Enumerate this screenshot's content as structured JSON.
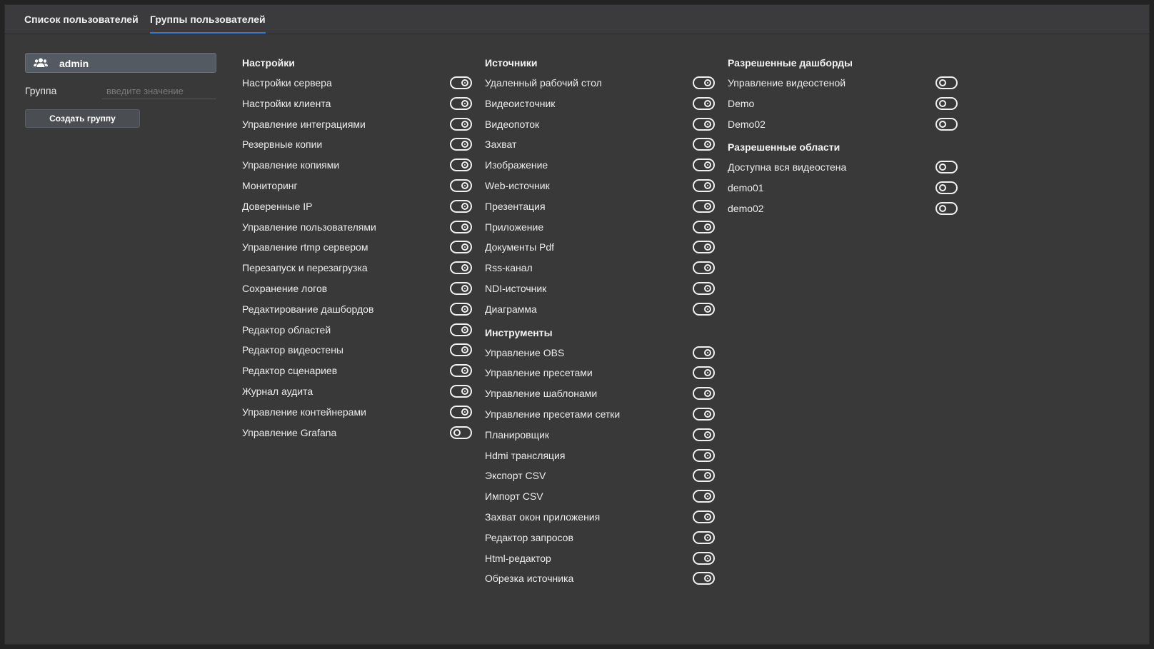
{
  "tabs": [
    {
      "label": "Список пользователей",
      "active": false
    },
    {
      "label": "Группы пользователей",
      "active": true
    }
  ],
  "sidebar": {
    "group_icon": "users-icon",
    "selected_group": "admin",
    "group_field_label": "Группа",
    "group_field_placeholder": "введите значение",
    "create_button": "Создать группу"
  },
  "settings": {
    "title": "Настройки",
    "items": [
      {
        "label": "Настройки сервера",
        "on": true
      },
      {
        "label": "Настройки клиента",
        "on": true
      },
      {
        "label": "Управление интеграциями",
        "on": true
      },
      {
        "label": "Резервные копии",
        "on": true
      },
      {
        "label": "Управление копиями",
        "on": true
      },
      {
        "label": "Мониторинг",
        "on": true
      },
      {
        "label": "Доверенные IP",
        "on": true
      },
      {
        "label": "Управление пользователями",
        "on": true
      },
      {
        "label": "Управление rtmp сервером",
        "on": true
      },
      {
        "label": "Перезапуск и перезагрузка",
        "on": true
      },
      {
        "label": "Сохранение логов",
        "on": true
      },
      {
        "label": "Редактирование дашбордов",
        "on": true
      },
      {
        "label": "Редактор областей",
        "on": true
      },
      {
        "label": "Редактор видеостены",
        "on": true
      },
      {
        "label": "Редактор сценариев",
        "on": true
      },
      {
        "label": "Журнал аудита",
        "on": true
      },
      {
        "label": "Управление контейнерами",
        "on": true
      },
      {
        "label": "Управление Grafana",
        "on": false
      }
    ]
  },
  "sources": {
    "title": "Источники",
    "items": [
      {
        "label": "Удаленный рабочий стол",
        "on": true
      },
      {
        "label": "Видеоисточник",
        "on": true
      },
      {
        "label": "Видеопоток",
        "on": true
      },
      {
        "label": "Захват",
        "on": true
      },
      {
        "label": "Изображение",
        "on": true
      },
      {
        "label": "Web-источник",
        "on": true
      },
      {
        "label": "Презентация",
        "on": true
      },
      {
        "label": "Приложение",
        "on": true
      },
      {
        "label": "Документы Pdf",
        "on": true
      },
      {
        "label": "Rss-канал",
        "on": true
      },
      {
        "label": "NDI-источник",
        "on": true
      },
      {
        "label": "Диаграмма",
        "on": true
      }
    ]
  },
  "tools": {
    "title": "Инструменты",
    "items": [
      {
        "label": "Управление OBS",
        "on": true
      },
      {
        "label": "Управление пресетами",
        "on": true
      },
      {
        "label": "Управление шаблонами",
        "on": true
      },
      {
        "label": "Управление пресетами сетки",
        "on": true
      },
      {
        "label": "Планировщик",
        "on": true
      },
      {
        "label": "Hdmi трансляция",
        "on": true
      },
      {
        "label": "Экспорт CSV",
        "on": true
      },
      {
        "label": "Импорт CSV",
        "on": true
      },
      {
        "label": "Захват окон приложения",
        "on": true
      },
      {
        "label": "Редактор запросов",
        "on": true
      },
      {
        "label": "Html-редактор",
        "on": true
      },
      {
        "label": "Обрезка источника",
        "on": true
      }
    ]
  },
  "dashboards": {
    "title": "Разрешенные дашборды",
    "items": [
      {
        "label": "Управление видеостеной",
        "on": false
      },
      {
        "label": "Demo",
        "on": false
      },
      {
        "label": "Demo02",
        "on": false
      }
    ]
  },
  "areas": {
    "title": "Разрешенные области",
    "items": [
      {
        "label": "Доступна вся видеостена",
        "on": false
      },
      {
        "label": "demo01",
        "on": false
      },
      {
        "label": "demo02",
        "on": false
      }
    ]
  }
}
